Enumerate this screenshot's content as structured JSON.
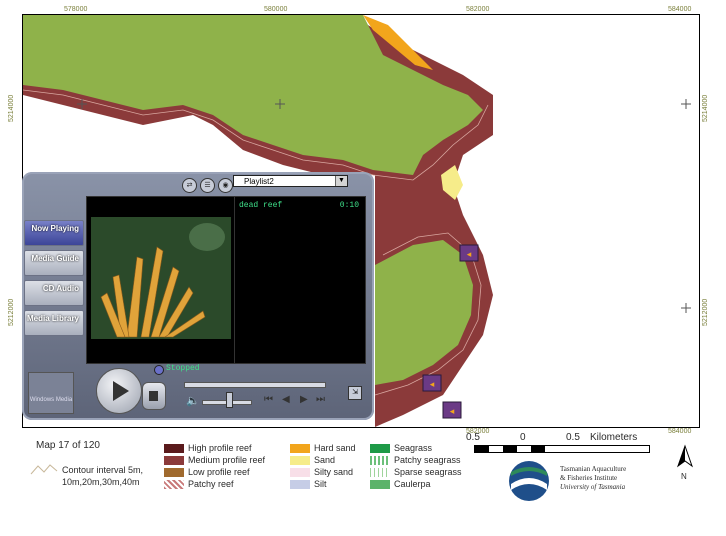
{
  "map": {
    "x_labels": [
      "578000",
      "580000",
      "582000",
      "584000"
    ],
    "y_labels": [
      "5214000",
      "5212000"
    ]
  },
  "player": {
    "playlist": "Playlist2",
    "sidebar": [
      {
        "label": "Now Playing",
        "active": true
      },
      {
        "label": "Media Guide",
        "active": false
      },
      {
        "label": "CD Audio",
        "active": false
      },
      {
        "label": "Media Library",
        "active": false
      }
    ],
    "track_title": "dead reef",
    "track_time": "0:10",
    "status": "Stopped",
    "icons": [
      "play-icon",
      "stop-icon",
      "mute-icon",
      "previous-icon",
      "rewind-icon",
      "forward-icon",
      "next-icon",
      "resize-icon"
    ],
    "logo_text": "Windows Media"
  },
  "legend": {
    "map_number": "Map 17 of 120",
    "contour_label_line1": "Contour interval 5m,",
    "contour_label_line2": "10m,20m,30m,40m",
    "items": [
      {
        "label": "High profile reef",
        "color": "#5a1a1c"
      },
      {
        "label": "Medium profile reef",
        "color": "#8b3a3a"
      },
      {
        "label": "Low profile reef",
        "color": "#a06a2e"
      },
      {
        "label": "Patchy reef",
        "color": "#c97a7a"
      },
      {
        "label": "Hard sand",
        "color": "#f2a51c"
      },
      {
        "label": "Sand",
        "color": "#f6ec8a"
      },
      {
        "label": "Silty sand",
        "color": "#f8dfe8"
      },
      {
        "label": "Silt",
        "color": "#c6cde6"
      },
      {
        "label": "Seagrass",
        "color": "#1e9a47"
      },
      {
        "label": "Patchy seagrass",
        "color": "#6cc07a"
      },
      {
        "label": "Sparse seagrass",
        "color": "#9fd49c"
      },
      {
        "label": "Caulerpa",
        "color": "#5bb36a"
      }
    ],
    "scale_labels": [
      "0.5",
      "0",
      "0.5",
      "Kilometers"
    ],
    "org_line1": "Tasmanian Aquaculture",
    "org_line2": "& Fisheries Institute",
    "org_line3": "University of Tasmania",
    "north_label": "N"
  },
  "colors": {
    "land": "#8fb24a",
    "reef": "#8b3a3a",
    "player_accent": "#3c4598"
  }
}
